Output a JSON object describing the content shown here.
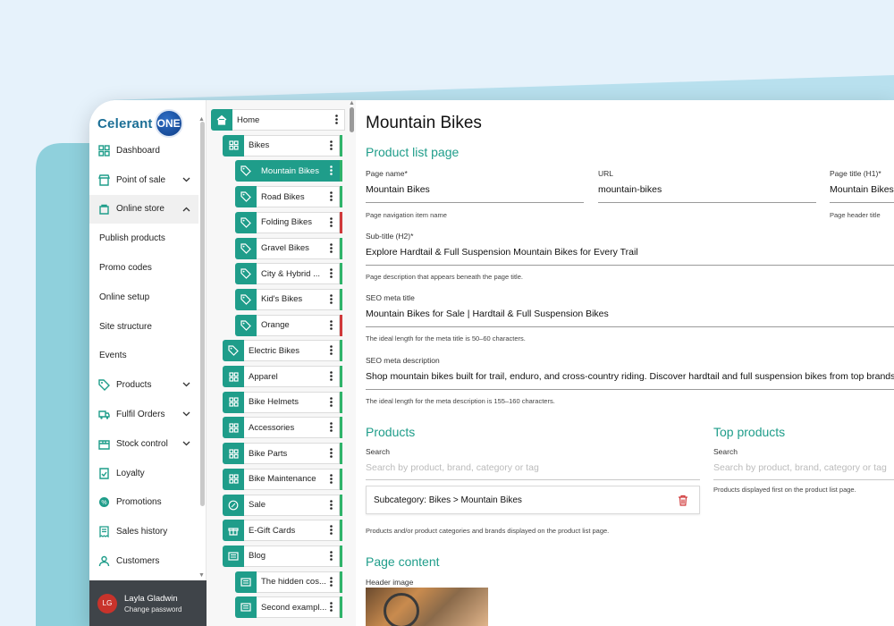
{
  "nav": {
    "logo_text": "Celerant",
    "logo_badge": "ONE",
    "items": [
      {
        "label": "Dashboard",
        "icon": "grid-icon",
        "chevron": ""
      },
      {
        "label": "Point of sale",
        "icon": "store-icon",
        "chevron": "down"
      },
      {
        "label": "Online store",
        "icon": "cart-icon",
        "chevron": "up",
        "active": true
      },
      {
        "label": "Publish products",
        "sub": true
      },
      {
        "label": "Promo codes",
        "sub": true
      },
      {
        "label": "Online setup",
        "sub": true
      },
      {
        "label": "Site structure",
        "sub": true
      },
      {
        "label": "Events",
        "sub": true
      },
      {
        "label": "Products",
        "icon": "tag-icon",
        "chevron": "down"
      },
      {
        "label": "Fulfil Orders",
        "icon": "truck-icon",
        "chevron": "down"
      },
      {
        "label": "Stock control",
        "icon": "box-icon",
        "chevron": "down"
      },
      {
        "label": "Loyalty",
        "icon": "loyalty-icon",
        "chevron": ""
      },
      {
        "label": "Promotions",
        "icon": "badge-icon",
        "chevron": ""
      },
      {
        "label": "Sales history",
        "icon": "receipt-icon",
        "chevron": ""
      },
      {
        "label": "Customers",
        "icon": "user-icon",
        "chevron": ""
      }
    ],
    "user": {
      "initials": "LG",
      "name": "Layla Gladwin",
      "link": "Change password"
    }
  },
  "tree": {
    "items": [
      {
        "label": "Home",
        "icon": "home",
        "level": 0,
        "flag": ""
      },
      {
        "label": "Bikes",
        "icon": "grid",
        "level": 1,
        "flag": "#2fb36a"
      },
      {
        "label": "Mountain Bikes",
        "icon": "tag",
        "level": 2,
        "flag": "#2fb36a",
        "selected": true
      },
      {
        "label": "Road Bikes",
        "icon": "tag",
        "level": 2,
        "flag": "#2fb36a"
      },
      {
        "label": "Folding Bikes",
        "icon": "tag",
        "level": 2,
        "flag": "#d0393a"
      },
      {
        "label": "Gravel Bikes",
        "icon": "tag",
        "level": 2,
        "flag": "#2fb36a"
      },
      {
        "label": "City & Hybrid ...",
        "icon": "tag",
        "level": 2,
        "flag": "#2fb36a"
      },
      {
        "label": "Kid's Bikes",
        "icon": "tag",
        "level": 2,
        "flag": "#2fb36a"
      },
      {
        "label": "Orange",
        "icon": "tag",
        "level": 2,
        "flag": "#d0393a"
      },
      {
        "label": "Electric Bikes",
        "icon": "tag",
        "level": 1,
        "flag": "#2fb36a"
      },
      {
        "label": "Apparel",
        "icon": "grid",
        "level": 1,
        "flag": "#2fb36a"
      },
      {
        "label": "Bike Helmets",
        "icon": "grid",
        "level": 1,
        "flag": "#2fb36a"
      },
      {
        "label": "Accessories",
        "icon": "grid",
        "level": 1,
        "flag": "#2fb36a"
      },
      {
        "label": "Bike Parts",
        "icon": "grid",
        "level": 1,
        "flag": "#2fb36a"
      },
      {
        "label": "Bike Maintenance",
        "icon": "grid",
        "level": 1,
        "flag": "#2fb36a"
      },
      {
        "label": "Sale",
        "icon": "badge",
        "level": 1,
        "flag": "#2fb36a"
      },
      {
        "label": "E-Gift Cards",
        "icon": "gift",
        "level": 1,
        "flag": "#2fb36a"
      },
      {
        "label": "Blog",
        "icon": "doc",
        "level": 1,
        "flag": "#2fb36a"
      },
      {
        "label": "The hidden cos...",
        "icon": "doc",
        "level": 2,
        "flag": "#2fb36a"
      },
      {
        "label": "Second exampl...",
        "icon": "doc",
        "level": 2,
        "flag": "#2fb36a"
      }
    ]
  },
  "main": {
    "title": "Mountain Bikes",
    "product_list_heading": "Product list page",
    "page_name": {
      "label": "Page name*",
      "value": "Mountain Bikes",
      "hint": "Page navigation item name"
    },
    "url": {
      "label": "URL",
      "value": "mountain-bikes"
    },
    "page_title": {
      "label": "Page title (H1)*",
      "value": "Mountain Bikes",
      "hint": "Page header title"
    },
    "subtitle": {
      "label": "Sub-title (H2)*",
      "value": "Explore Hardtail & Full Suspension Mountain Bikes for Every Trail",
      "hint": "Page description that appears beneath the page title."
    },
    "seo_title": {
      "label": "SEO meta title",
      "value": "Mountain Bikes for Sale | Hardtail & Full Suspension Bikes",
      "hint": "The ideal length for the meta title is 50–60 characters."
    },
    "seo_desc": {
      "label": "SEO meta description",
      "value": "Shop mountain bikes built for trail, enduro, and cross-country riding. Discover hardtail and full suspension bikes from top brands",
      "hint": "The ideal length for the meta description is 155–160 characters."
    },
    "products": {
      "heading": "Products",
      "search_label": "Search",
      "search_placeholder": "Search by product, brand, category or tag",
      "chip": "Subcategory: Bikes > Mountain Bikes",
      "hint": "Products and/or product categories and brands displayed on the product list page."
    },
    "top_products": {
      "heading": "Top products",
      "search_label": "Search",
      "search_placeholder": "Search by product, brand, category or tag",
      "hint": "Products displayed first on the product list page."
    },
    "page_content": {
      "heading": "Page content",
      "header_image_label": "Header image"
    }
  },
  "colors": {
    "accent": "#1f9d8a",
    "active_flag": "#2fb36a",
    "inactive_flag": "#d0393a",
    "user_bar": "#3f4449"
  }
}
